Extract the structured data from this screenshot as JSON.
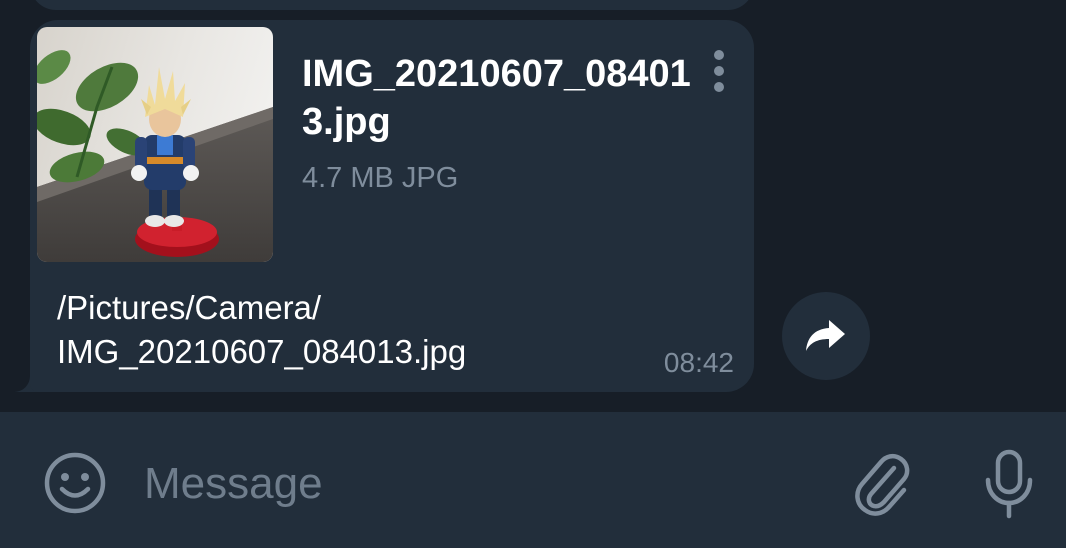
{
  "message": {
    "file_name": "IMG_20210607_084013.jpg",
    "file_meta": "4.7 MB JPG",
    "caption": "/Pictures/Camera/\nIMG_20210607_084013.jpg",
    "time": "08:42"
  },
  "input": {
    "placeholder": "Message"
  },
  "icons": {
    "menu": "more-vertical-icon",
    "share": "forward-arrow-icon",
    "emoji": "smiley-icon",
    "attach": "paperclip-icon",
    "mic": "microphone-icon"
  },
  "colors": {
    "background": "#171e27",
    "bubble": "#222e3b",
    "text_primary": "#ffffff",
    "text_secondary": "#7f8d9c"
  }
}
